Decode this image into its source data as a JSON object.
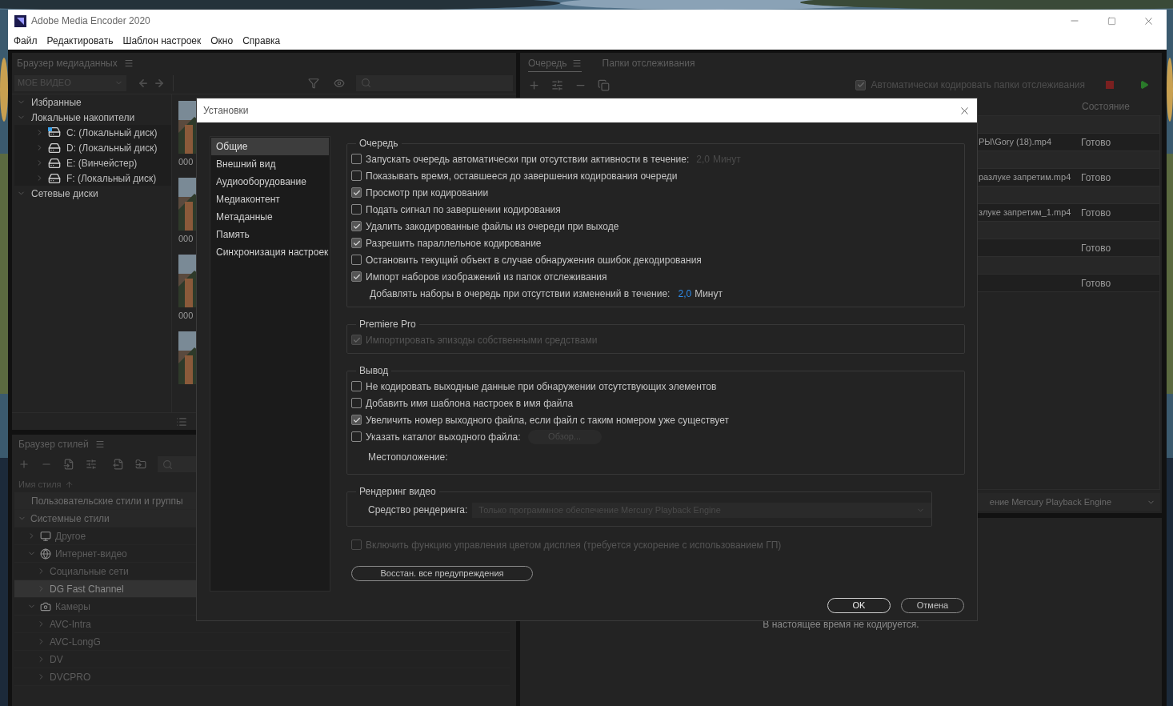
{
  "window": {
    "title": "Adobe Media Encoder 2020"
  },
  "menu": [
    "Файл",
    "Редактировать",
    "Шаблон настроек",
    "Окно",
    "Справка"
  ],
  "media_browser": {
    "title": "Браузер медиаданных",
    "location": "МОЕ ВИДЕО",
    "tree": [
      {
        "label": "Избранные",
        "expanded": true
      },
      {
        "label": "Локальные накопители",
        "expanded": true,
        "children": [
          {
            "label": "C: (Локальный диск)",
            "kind": "system_drive",
            "expanded": false
          },
          {
            "label": "D: (Локальный диск)",
            "kind": "drive",
            "expanded": false
          },
          {
            "label": "E: (Винчейстер)",
            "kind": "drive",
            "expanded": false
          },
          {
            "label": "F: (Локальный диск)",
            "kind": "drive",
            "expanded": false
          }
        ]
      },
      {
        "label": "Сетевые диски",
        "expanded": true
      }
    ],
    "thumbnails": [
      {
        "kind": "picture",
        "label": "000"
      },
      {
        "kind": "picture",
        "label": "000"
      },
      {
        "kind": "picture",
        "label": "000"
      },
      {
        "kind": "picture"
      }
    ]
  },
  "style_browser": {
    "title": "Браузер стилей",
    "sort_column": "Имя стиля",
    "tree": [
      {
        "label": "Пользовательские стили и группы",
        "selected": false
      },
      {
        "label": "Системные стили",
        "expanded": true,
        "selected": false,
        "children": [
          {
            "label": "Другое",
            "kind": "device",
            "expanded": false,
            "selected": false
          },
          {
            "label": "Интернет-видео",
            "kind": "web",
            "expanded": true,
            "selected": false,
            "children": [
              {
                "label": "Социальные сети",
                "expanded": false,
                "selected": false
              },
              {
                "label": "DG Fast Channel",
                "expanded": false,
                "selected": true
              }
            ]
          },
          {
            "label": "Камеры",
            "kind": "camera",
            "expanded": true,
            "selected": false,
            "children": [
              {
                "label": "AVC-Intra",
                "expanded": false,
                "selected": false
              },
              {
                "label": "AVC-LongG",
                "expanded": false,
                "selected": false
              },
              {
                "label": "DV",
                "expanded": false,
                "selected": false
              },
              {
                "label": "DVCPRO",
                "expanded": false,
                "selected": false
              }
            ]
          }
        ]
      }
    ]
  },
  "queue": {
    "tabs": [
      {
        "label": "Очередь",
        "selected": true
      },
      {
        "label": "Папки отслеживания",
        "selected": false
      }
    ],
    "auto_encode": {
      "label": "Автоматически кодировать папки отслеживания",
      "checked": true
    },
    "columns": [
      "Состояние"
    ],
    "rows": [
      {
        "file": "РЫ\\Gory (18).mp4",
        "status": "Готово"
      },
      {
        "file": "разлуке запретим.mp4",
        "status": "Готово"
      },
      {
        "file": "злуке запретим_1.mp4",
        "status": "Готово"
      },
      {
        "status": "Готово"
      },
      {
        "status": "Готово"
      }
    ],
    "renderer": "ение Mercury Playback Engine",
    "encoding_status": "В настоящее время не кодируется."
  },
  "dialog": {
    "title": "Установки",
    "categories": [
      {
        "label": "Общие",
        "selected": true
      },
      {
        "label": "Внешний вид",
        "selected": false
      },
      {
        "label": "Аудиооборудование",
        "selected": false
      },
      {
        "label": "Медиаконтент",
        "selected": false
      },
      {
        "label": "Метаданные",
        "selected": false
      },
      {
        "label": "Память",
        "selected": false
      },
      {
        "label": "Синхронизация настроек",
        "selected": false
      }
    ],
    "sections": [
      {
        "kind": "group",
        "title": "Очередь",
        "narrow": false,
        "items": [
          {
            "kind": "checkbox",
            "label": "Запускать очередь автоматически при отсутствии активности в течение:",
            "checked": false,
            "disabled": false,
            "suffix": {
              "value": "2,0",
              "unit": "Минут",
              "disabled": true
            }
          },
          {
            "kind": "checkbox",
            "label": "Показывать время, оставшееся до завершения кодирования очереди",
            "checked": false,
            "disabled": false
          },
          {
            "kind": "checkbox",
            "label": "Просмотр при кодировании",
            "checked": true,
            "disabled": false
          },
          {
            "kind": "checkbox",
            "label": "Подать сигнал по завершении кодирования",
            "checked": false,
            "disabled": false
          },
          {
            "kind": "checkbox",
            "label": "Удалить закодированные файлы из очереди при выходе",
            "checked": true,
            "disabled": false
          },
          {
            "kind": "checkbox",
            "label": "Разрешить параллельное кодирование",
            "checked": true,
            "disabled": false
          },
          {
            "kind": "checkbox",
            "label": "Остановить текущий объект в случае обнаружения ошибок декодирования",
            "checked": false,
            "disabled": false
          },
          {
            "kind": "checkbox",
            "label": "Импорт наборов изображений из папок отслеживания",
            "checked": true,
            "disabled": false
          },
          {
            "kind": "spinner",
            "label": "Добавлять наборы в очередь при отсутствии изменений в течение:",
            "value": "2,0",
            "unit": "Минут"
          }
        ]
      },
      {
        "kind": "group",
        "title": "Premiere Pro",
        "narrow": false,
        "items": [
          {
            "kind": "checkbox",
            "label": "Импортировать эпизоды собственными средствами",
            "checked": true,
            "disabled": true
          }
        ]
      },
      {
        "kind": "group",
        "title": "Вывод",
        "narrow": false,
        "items": [
          {
            "kind": "checkbox",
            "label": "Не кодировать выходные данные при обнаружении отсутствующих элементов",
            "checked": false,
            "disabled": false
          },
          {
            "kind": "checkbox",
            "label": "Добавить имя шаблона настроек в имя файла",
            "checked": false,
            "disabled": false
          },
          {
            "kind": "checkbox",
            "label": "Увеличить номер выходного файла, если файл с таким номером уже существует",
            "checked": true,
            "disabled": false
          },
          {
            "kind": "checkbox",
            "label": "Указать каталог выходного файла:",
            "checked": false,
            "disabled": false,
            "button": {
              "label": "Обзор...",
              "disabled": true
            }
          },
          {
            "kind": "location",
            "label": "Местоположение:"
          }
        ]
      },
      {
        "kind": "group",
        "title": "Рендеринг видео",
        "narrow": true,
        "items": [
          {
            "kind": "dropdown",
            "label": "Средство рендеринга:",
            "value": "Только программное обеспечение Mercury Playback Engine",
            "disabled": true
          }
        ]
      },
      {
        "kind": "checkbox",
        "label": "Включить функцию управления цветом дисплея  (требуется ускорение с использованием ГП)",
        "checked": false,
        "disabled": true
      },
      {
        "kind": "button",
        "label": "Восстан. все предупреждения"
      }
    ],
    "buttons": [
      {
        "label": "OK",
        "default": true
      },
      {
        "label": "Отмена",
        "default": false
      }
    ]
  }
}
